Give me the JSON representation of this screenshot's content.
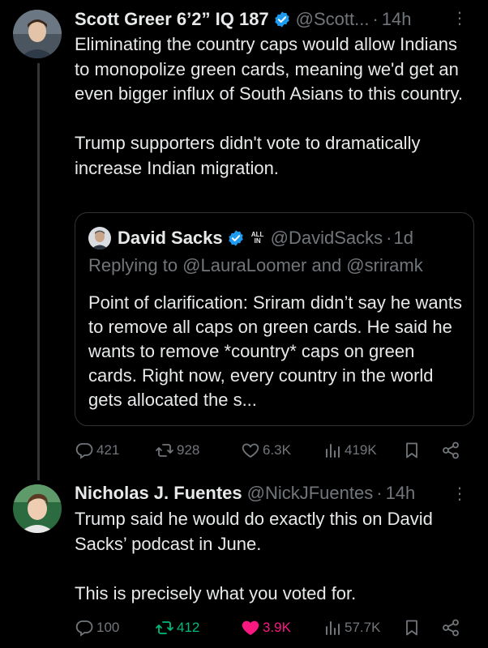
{
  "tweet1": {
    "name": "Scott Greer 6’2” IQ 187",
    "handle": "@Scott...",
    "dot": "·",
    "time": "14h",
    "text": "Eliminating the country caps would allow Indians to monopolize green cards, meaning we'd get an even bigger influx of South Asians to this country.\n\nTrump supporters didn't vote to dramatically increase Indian migration.",
    "quote": {
      "name": "David Sacks",
      "badge": [
        "ALL",
        "IN"
      ],
      "handle": "@DavidSacks",
      "dot": "·",
      "time": "1d",
      "replying": "Replying to @LauraLoomer and @sriramk",
      "text": "Point of clarification: Sriram didn’t say he wants to remove all caps on green cards. He said he wants to remove *country* caps on green cards. Right now, every country in the world gets allocated the s..."
    },
    "stats": {
      "replies": "421",
      "reposts": "928",
      "likes": "6.3K",
      "views": "419K"
    }
  },
  "tweet2": {
    "name": "Nicholas J. Fuentes",
    "handle": "@NickJFuentes",
    "dot": "·",
    "time": "14h",
    "text": "Trump said he would do exactly this on David Sacks’ podcast in June.\n\nThis is precisely what you voted for.",
    "stats": {
      "replies": "100",
      "reposts": "412",
      "likes": "3.9K",
      "views": "57.7K"
    },
    "reposted": true,
    "liked": true
  },
  "colors": {
    "background": "#000000",
    "text": "#e7e9ea",
    "muted": "#71767b",
    "verified": "#1d9bf0",
    "repost_active": "#00ba7c",
    "like_active": "#f91880"
  },
  "icons": [
    "verified-badge-icon",
    "more-icon",
    "reply-icon",
    "repost-icon",
    "like-icon",
    "views-icon",
    "bookmark-icon",
    "share-icon"
  ]
}
